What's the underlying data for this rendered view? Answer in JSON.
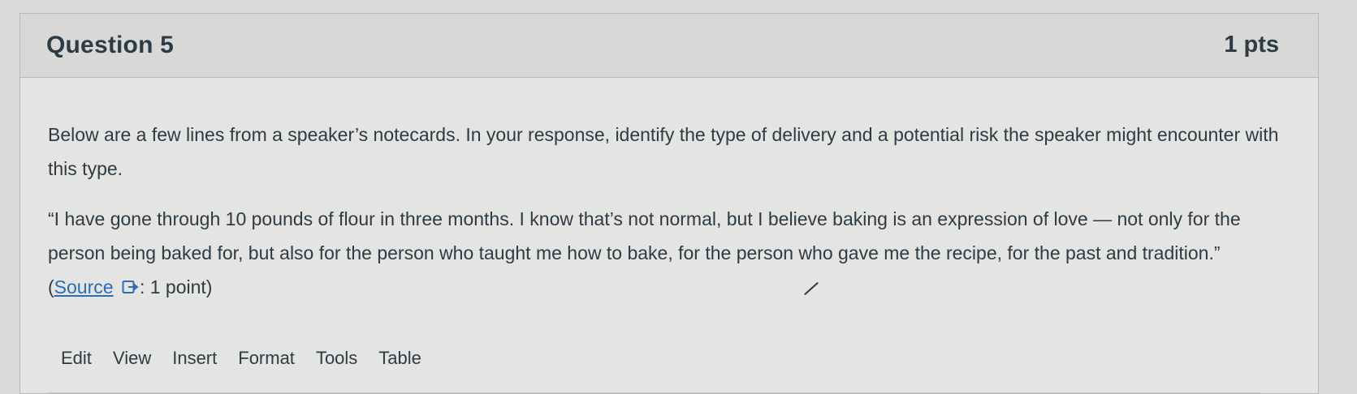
{
  "question": {
    "title": "Question 5",
    "points": "1 pts"
  },
  "body": {
    "prompt": "Below are a few lines from a speaker’s notecards. In your response, identify the type of delivery and a potential risk the speaker might encounter with this type.",
    "quote_text": "“I have gone through 10 pounds of flour in three months. I know that’s not normal, but I believe baking is an expression of love — not only for the person being baked for, but also for the person who taught me how to bake, for the person who gave me the recipe, for the past and tradition.” (",
    "source_link": "Source",
    "suffix": ": 1 point)"
  },
  "editor": {
    "menu": [
      "Edit",
      "View",
      "Insert",
      "Format",
      "Tools",
      "Table"
    ]
  },
  "colors": {
    "link": "#2a6db1",
    "text": "#2d3b45"
  },
  "icons": {
    "external_link": "external-link-icon"
  }
}
